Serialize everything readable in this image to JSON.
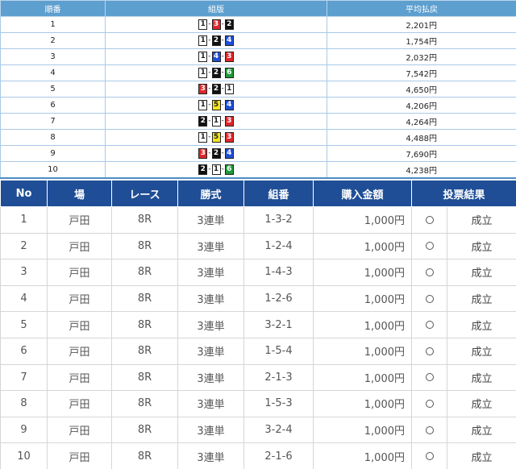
{
  "payout_table": {
    "headers": {
      "rank": "順番",
      "combination": "組版",
      "avg_payout": "平均払戻"
    },
    "rows": [
      {
        "rank": "1",
        "boats": [
          1,
          3,
          2
        ],
        "payout": "2,201円"
      },
      {
        "rank": "2",
        "boats": [
          1,
          2,
          4
        ],
        "payout": "1,754円"
      },
      {
        "rank": "3",
        "boats": [
          1,
          4,
          3
        ],
        "payout": "2,032円"
      },
      {
        "rank": "4",
        "boats": [
          1,
          2,
          6
        ],
        "payout": "7,542円"
      },
      {
        "rank": "5",
        "boats": [
          3,
          2,
          1
        ],
        "payout": "4,650円"
      },
      {
        "rank": "6",
        "boats": [
          1,
          5,
          4
        ],
        "payout": "4,206円"
      },
      {
        "rank": "7",
        "boats": [
          2,
          1,
          3
        ],
        "payout": "4,264円"
      },
      {
        "rank": "8",
        "boats": [
          1,
          5,
          3
        ],
        "payout": "4,488円"
      },
      {
        "rank": "9",
        "boats": [
          3,
          2,
          4
        ],
        "payout": "7,690円"
      },
      {
        "rank": "10",
        "boats": [
          2,
          1,
          6
        ],
        "payout": "4,238円"
      }
    ]
  },
  "bet_table": {
    "headers": {
      "no": "No",
      "venue": "場",
      "race": "レース",
      "bet_type": "勝式",
      "combination": "組番",
      "amount": "購入金額",
      "result": "投票結果"
    },
    "rows": [
      {
        "no": "1",
        "venue": "戸田",
        "race": "8R",
        "bet_type": "3連単",
        "combination": "1-3-2",
        "amount": "1,000円",
        "status": "成立"
      },
      {
        "no": "2",
        "venue": "戸田",
        "race": "8R",
        "bet_type": "3連単",
        "combination": "1-2-4",
        "amount": "1,000円",
        "status": "成立"
      },
      {
        "no": "3",
        "venue": "戸田",
        "race": "8R",
        "bet_type": "3連単",
        "combination": "1-4-3",
        "amount": "1,000円",
        "status": "成立"
      },
      {
        "no": "4",
        "venue": "戸田",
        "race": "8R",
        "bet_type": "3連単",
        "combination": "1-2-6",
        "amount": "1,000円",
        "status": "成立"
      },
      {
        "no": "5",
        "venue": "戸田",
        "race": "8R",
        "bet_type": "3連単",
        "combination": "3-2-1",
        "amount": "1,000円",
        "status": "成立"
      },
      {
        "no": "6",
        "venue": "戸田",
        "race": "8R",
        "bet_type": "3連単",
        "combination": "1-5-4",
        "amount": "1,000円",
        "status": "成立"
      },
      {
        "no": "7",
        "venue": "戸田",
        "race": "8R",
        "bet_type": "3連単",
        "combination": "2-1-3",
        "amount": "1,000円",
        "status": "成立"
      },
      {
        "no": "8",
        "venue": "戸田",
        "race": "8R",
        "bet_type": "3連単",
        "combination": "1-5-3",
        "amount": "1,000円",
        "status": "成立"
      },
      {
        "no": "9",
        "venue": "戸田",
        "race": "8R",
        "bet_type": "3連単",
        "combination": "3-2-4",
        "amount": "1,000円",
        "status": "成立"
      },
      {
        "no": "10",
        "venue": "戸田",
        "race": "8R",
        "bet_type": "3連単",
        "combination": "2-1-6",
        "amount": "1,000円",
        "status": "成立"
      }
    ]
  }
}
